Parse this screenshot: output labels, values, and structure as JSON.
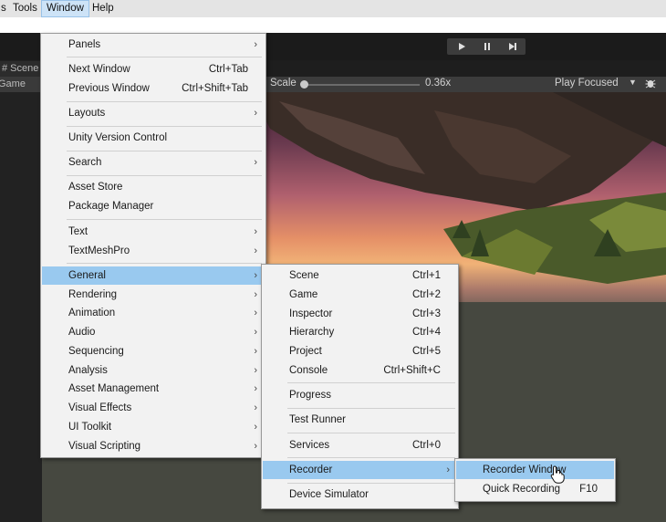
{
  "menubar": {
    "items": [
      {
        "label": "s",
        "active": false
      },
      {
        "label": "Tools",
        "active": false
      },
      {
        "label": "Window",
        "active": true
      },
      {
        "label": "Help",
        "active": false
      }
    ]
  },
  "toolbar": {
    "play_icon": "play-icon",
    "pause_icon": "pause-icon",
    "step_icon": "step-icon"
  },
  "tabs": {
    "scene": "# Scene",
    "game": "Game"
  },
  "gamebar": {
    "scale_label": "Scale",
    "scale_value": 0.36,
    "scale_text": "0.36x",
    "play_mode": "Play Focused"
  },
  "window_menu": {
    "items": [
      {
        "label": "Panels",
        "shortcut": "",
        "submenu": true
      },
      {
        "sep": true
      },
      {
        "label": "Next Window",
        "shortcut": "Ctrl+Tab",
        "submenu": false
      },
      {
        "label": "Previous Window",
        "shortcut": "Ctrl+Shift+Tab",
        "submenu": false
      },
      {
        "sep": true
      },
      {
        "label": "Layouts",
        "shortcut": "",
        "submenu": true
      },
      {
        "sep": true
      },
      {
        "label": "Unity Version Control",
        "shortcut": "",
        "submenu": false
      },
      {
        "sep": true
      },
      {
        "label": "Search",
        "shortcut": "",
        "submenu": true
      },
      {
        "sep": true
      },
      {
        "label": "Asset Store",
        "shortcut": "",
        "submenu": false
      },
      {
        "label": "Package Manager",
        "shortcut": "",
        "submenu": false
      },
      {
        "sep": true
      },
      {
        "label": "Text",
        "shortcut": "",
        "submenu": true
      },
      {
        "label": "TextMeshPro",
        "shortcut": "",
        "submenu": true
      },
      {
        "sep": true
      },
      {
        "label": "General",
        "shortcut": "",
        "submenu": true,
        "highlighted": true
      },
      {
        "label": "Rendering",
        "shortcut": "",
        "submenu": true
      },
      {
        "label": "Animation",
        "shortcut": "",
        "submenu": true
      },
      {
        "label": "Audio",
        "shortcut": "",
        "submenu": true
      },
      {
        "label": "Sequencing",
        "shortcut": "",
        "submenu": true
      },
      {
        "label": "Analysis",
        "shortcut": "",
        "submenu": true
      },
      {
        "label": "Asset Management",
        "shortcut": "",
        "submenu": true
      },
      {
        "label": "Visual Effects",
        "shortcut": "",
        "submenu": true
      },
      {
        "label": "UI Toolkit",
        "shortcut": "",
        "submenu": true
      },
      {
        "label": "Visual Scripting",
        "shortcut": "",
        "submenu": true
      }
    ]
  },
  "general_menu": {
    "items": [
      {
        "label": "Scene",
        "shortcut": "Ctrl+1",
        "submenu": false
      },
      {
        "label": "Game",
        "shortcut": "Ctrl+2",
        "submenu": false
      },
      {
        "label": "Inspector",
        "shortcut": "Ctrl+3",
        "submenu": false
      },
      {
        "label": "Hierarchy",
        "shortcut": "Ctrl+4",
        "submenu": false
      },
      {
        "label": "Project",
        "shortcut": "Ctrl+5",
        "submenu": false
      },
      {
        "label": "Console",
        "shortcut": "Ctrl+Shift+C",
        "submenu": false
      },
      {
        "sep": true
      },
      {
        "label": "Progress",
        "shortcut": "",
        "submenu": false
      },
      {
        "sep": true
      },
      {
        "label": "Test Runner",
        "shortcut": "",
        "submenu": false
      },
      {
        "sep": true
      },
      {
        "label": "Services",
        "shortcut": "Ctrl+0",
        "submenu": false
      },
      {
        "sep": true
      },
      {
        "label": "Recorder",
        "shortcut": "",
        "submenu": true,
        "highlighted": true
      },
      {
        "sep": true
      },
      {
        "label": "Device Simulator",
        "shortcut": "",
        "submenu": false
      }
    ]
  },
  "recorder_menu": {
    "items": [
      {
        "label": "Recorder Window",
        "shortcut": "",
        "submenu": false,
        "highlighted": true
      },
      {
        "label": "Quick Recording",
        "shortcut": "F10",
        "submenu": false
      }
    ]
  },
  "colors": {
    "menu_bg": "#f2f2f2",
    "highlight": "#99c9ef",
    "editor_dark": "#1b1b1b"
  }
}
